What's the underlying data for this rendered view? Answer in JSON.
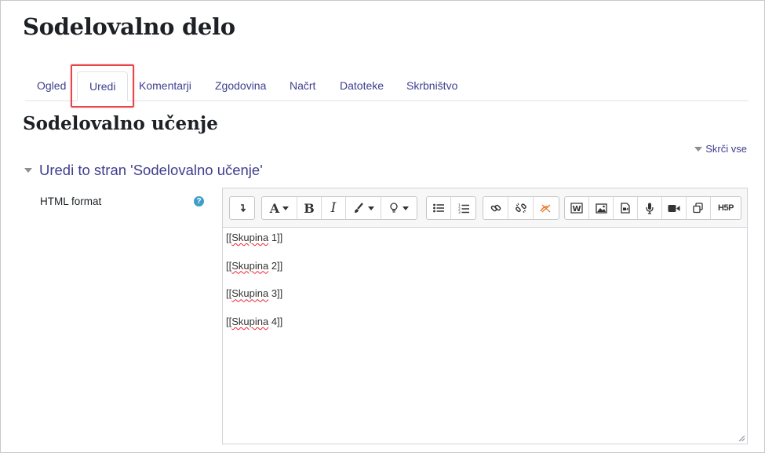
{
  "page": {
    "title": "Sodelovalno delo"
  },
  "tabs": [
    {
      "label": "Ogled"
    },
    {
      "label": "Uredi",
      "active": true
    },
    {
      "label": "Komentarji"
    },
    {
      "label": "Zgodovina"
    },
    {
      "label": "Načrt"
    },
    {
      "label": "Datoteke"
    },
    {
      "label": "Skrbništvo"
    }
  ],
  "section": {
    "title": "Sodelovalno učenje"
  },
  "collapse": {
    "label": "Skrči vse"
  },
  "fieldset": {
    "legend": "Uredi to stran 'Sodelovalno učenje'"
  },
  "field": {
    "label": "HTML format",
    "help_icon": "question-circle-icon"
  },
  "toolbar": {
    "icons": [
      "show-more-icon",
      "font-size-icon",
      "bold-icon",
      "italic-icon",
      "text-color-icon",
      "style-icon",
      "bullet-list-icon",
      "numbered-list-icon",
      "link-icon",
      "unlink-icon",
      "no-autolink-icon",
      "word-paste-icon",
      "image-icon",
      "media-icon",
      "record-audio-icon",
      "record-video-icon",
      "copy-icon",
      "h5p-icon"
    ],
    "bold": "B",
    "italic": "I",
    "font": "A",
    "h5p": "H5P"
  },
  "editor": {
    "lines": [
      {
        "prefix": "[[",
        "word": "Skupina",
        "suffix": " 1]]"
      },
      {
        "prefix": "[[",
        "word": "Skupina",
        "suffix": " 2]]"
      },
      {
        "prefix": "[[",
        "word": "Skupina",
        "suffix": " 3]]"
      },
      {
        "prefix": "[[",
        "word": "Skupina",
        "suffix": " 4]]"
      }
    ]
  },
  "colors": {
    "link": "#3e3e8f",
    "highlight": "#e8454a",
    "help": "#3d9fc7"
  }
}
